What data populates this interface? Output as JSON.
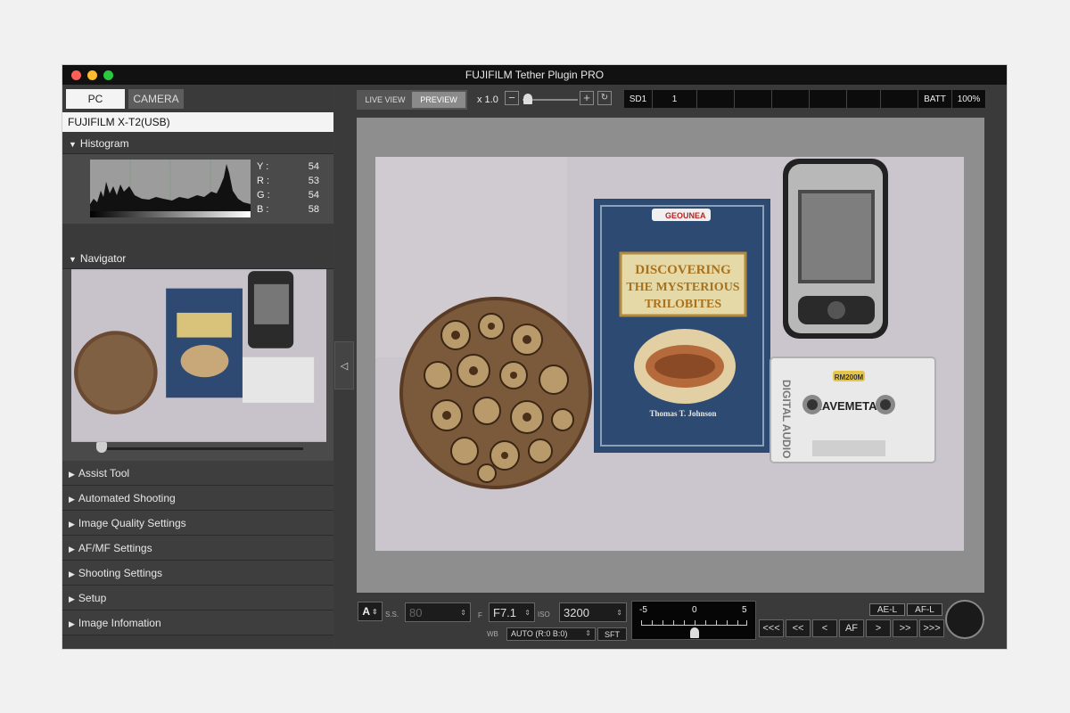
{
  "window": {
    "title": "FUJIFILM Tether Plugin PRO"
  },
  "left_panel": {
    "tabs": [
      {
        "label": "PC",
        "active": true
      },
      {
        "label": "CAMERA",
        "active": false
      }
    ],
    "device": "FUJIFILM X-T2(USB)",
    "histogram": {
      "title": "Histogram",
      "values": [
        {
          "label": "Y",
          "value": "54"
        },
        {
          "label": "R",
          "value": "53"
        },
        {
          "label": "G",
          "value": "54"
        },
        {
          "label": "B",
          "value": "58"
        }
      ]
    },
    "navigator": {
      "title": "Navigator",
      "zoom_fraction": 0.0
    },
    "menu": [
      "Assist Tool",
      "Automated Shooting",
      "Image Quality Settings",
      "AF/MF Settings",
      "Shooting Settings",
      "Setup",
      "Image Infomation"
    ]
  },
  "toolbar": {
    "live_view": "LIVE VIEW",
    "preview": "PREVIEW",
    "active_view": "PREVIEW",
    "zoom": "x 1.0",
    "zoom_minus": "−",
    "zoom_plus": "+",
    "status": {
      "slot": "SD1",
      "count": "1",
      "batt_label": "BATT",
      "batt_value": "100%"
    }
  },
  "controls": {
    "mode": "A",
    "ss_label": "S.S.",
    "shutter_speed": "80",
    "f_label": "F",
    "aperture": "F7.1",
    "iso_label": "ISO",
    "iso": "3200",
    "wb_label": "WB",
    "wb": "AUTO (R:0 B:0)",
    "sft": "SFT",
    "ev_scale": [
      "-5",
      "0",
      "5"
    ],
    "ev_value": 0,
    "ae_lock": "AE-L",
    "af_lock": "AF-L",
    "steps": [
      "<<<",
      "<<",
      "<",
      "AF",
      ">",
      ">>",
      ">>>"
    ]
  },
  "photo": {
    "book_title_line1": "DISCOVERING",
    "book_title_line2": "THE MYSTERIOUS",
    "book_title_line3": "TRILOBITES",
    "book_author": "Thomas T. Johnson",
    "book_logo": "GEOUNEA",
    "cassette_label": "RM200M",
    "cassette_brand": "RAVEMETAL",
    "cassette_side_text": "DIGITAL AUDIO"
  }
}
